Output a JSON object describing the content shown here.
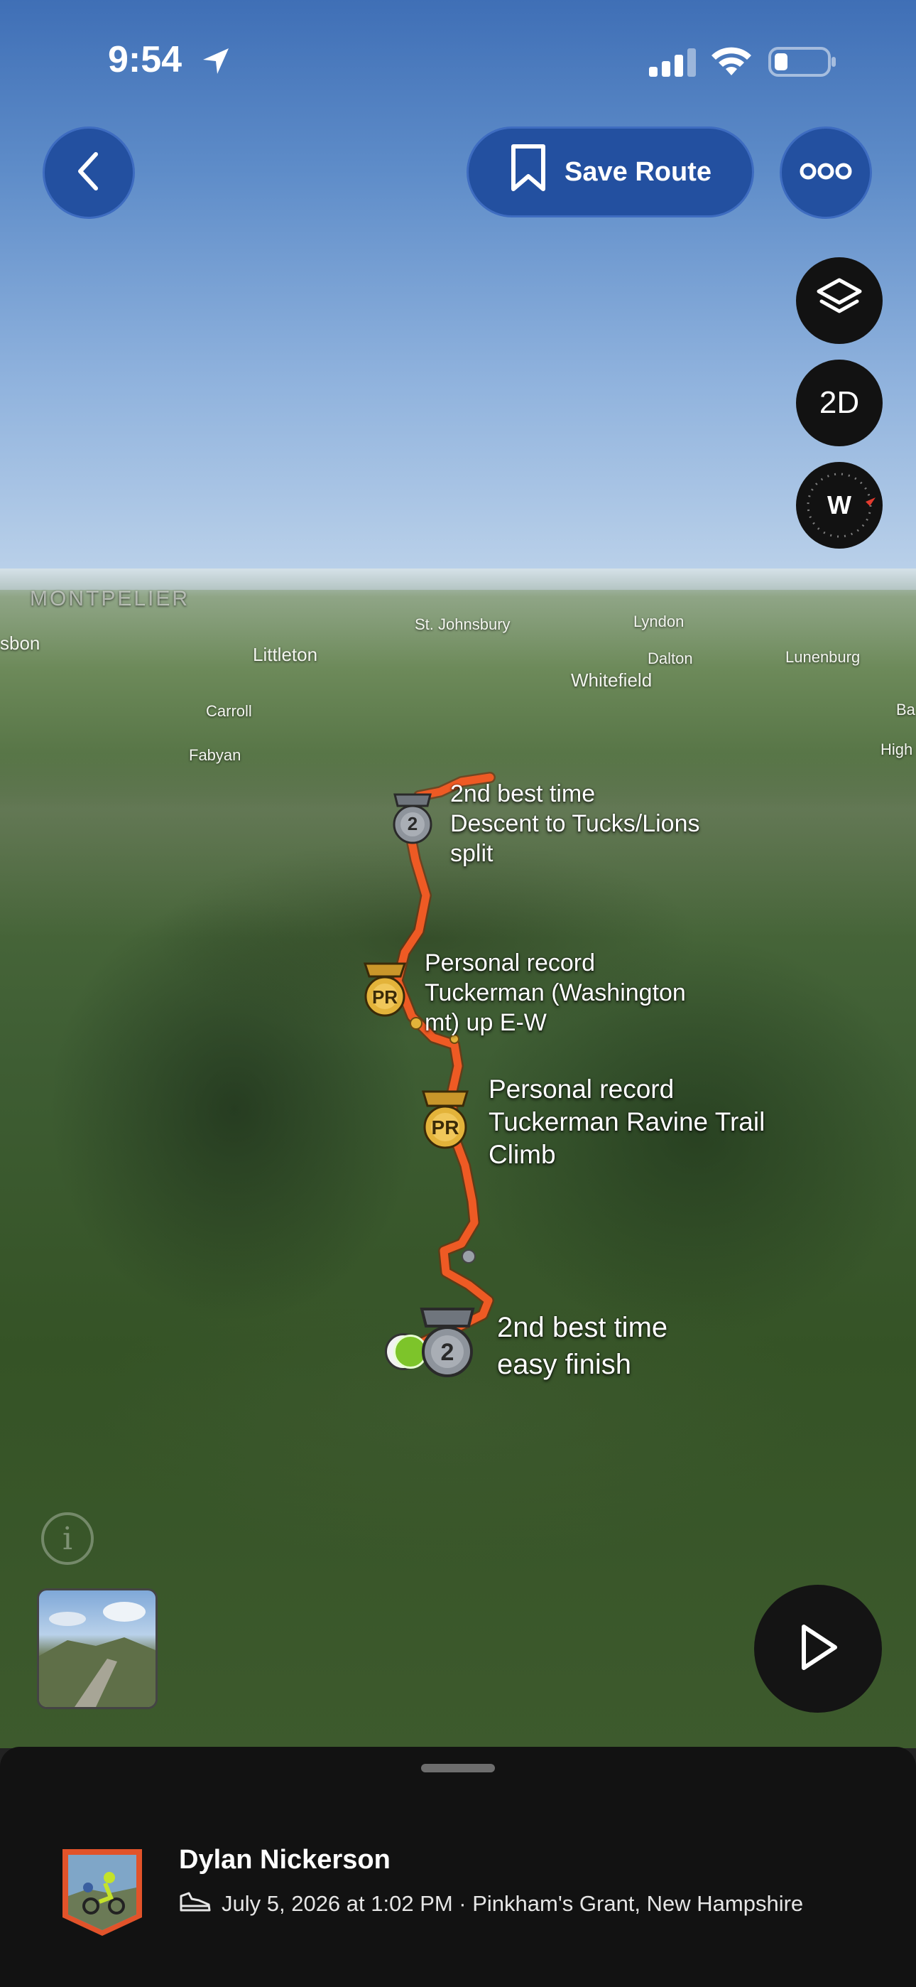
{
  "status_bar": {
    "time": "9:54"
  },
  "toolbar": {
    "save_route_label": "Save Route"
  },
  "map_controls": {
    "view_mode_label": "2D",
    "compass_label": "W"
  },
  "place_labels": [
    {
      "name": "MONTPELIER"
    },
    {
      "name": "sbon"
    },
    {
      "name": "St. Johnsbury"
    },
    {
      "name": "Lyndon"
    },
    {
      "name": "Littleton"
    },
    {
      "name": "Dalton"
    },
    {
      "name": "Lunenburg"
    },
    {
      "name": "Whitefield"
    },
    {
      "name": "Carroll"
    },
    {
      "name": "Ba"
    },
    {
      "name": "Fabyan"
    },
    {
      "name": "High"
    }
  ],
  "achievements": [
    {
      "badge": "2",
      "type": "2nd best time",
      "lines": [
        "2nd best time",
        "Descent to Tucks/Lions",
        "split"
      ]
    },
    {
      "badge": "PR",
      "type": "Personal record",
      "lines": [
        "Personal record",
        "Tuckerman (Washington",
        "mt) up E-W"
      ]
    },
    {
      "badge": "PR",
      "type": "Personal record",
      "lines": [
        "Personal record",
        "Tuckerman Ravine Trail",
        "Climb"
      ]
    },
    {
      "badge": "2",
      "type": "2nd best time",
      "lines": [
        "2nd best time",
        "easy finish"
      ]
    }
  ],
  "activity": {
    "athlete_name": "Dylan Nickerson",
    "meta": "July 5, 2026 at 1:02 PM · Pinkham's Grant, New Hampshire"
  },
  "colors": {
    "route": "#ee5a24",
    "accent_blue": "#2350a0",
    "pr_gold": "#e3b33a",
    "silver": "#8e949c",
    "sheet_bg": "#121212"
  }
}
